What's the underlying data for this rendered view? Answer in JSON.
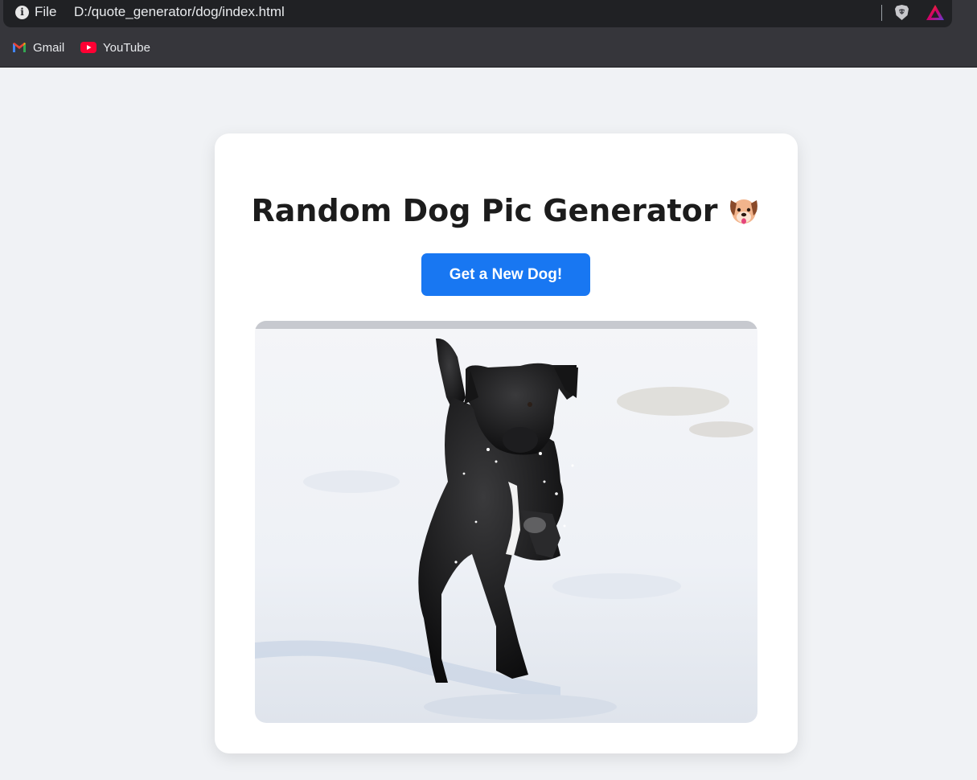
{
  "browser": {
    "scheme_label": "File",
    "url": "D:/quote_generator/dog/index.html",
    "bookmarks": [
      {
        "label": "Gmail",
        "icon": "gmail-icon"
      },
      {
        "label": "YouTube",
        "icon": "youtube-icon"
      }
    ],
    "colors": {
      "toolbar": "#36363b",
      "address_bar": "#202124"
    }
  },
  "page": {
    "title": "Random Dog Pic Generator",
    "title_emoji": "dog-face-icon",
    "button_label": "Get a New Dog!",
    "image": "black-dog-running-in-snow",
    "colors": {
      "background": "#f0f2f5",
      "card": "#ffffff",
      "accent": "#1877f2"
    }
  }
}
